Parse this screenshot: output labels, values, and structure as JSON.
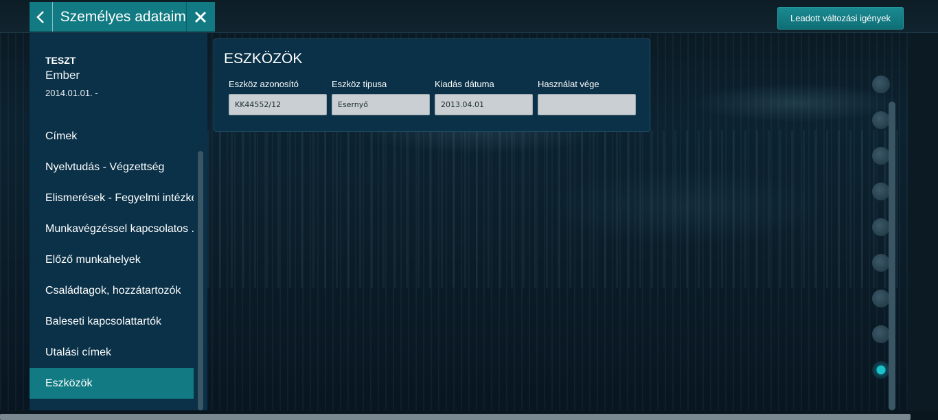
{
  "header": {
    "title": "Személyes adataim",
    "change_requests_button": "Leadott változási igények"
  },
  "user": {
    "name": "TESZT",
    "subname": "Ember",
    "date": "2014.01.01. -"
  },
  "sidebar": {
    "items": [
      {
        "label": "Címek"
      },
      {
        "label": "Nyelvtudás - Végzettség"
      },
      {
        "label": "Elismerések - Fegyelmi intézke."
      },
      {
        "label": "Munkavégzéssel kapcsolatos ..."
      },
      {
        "label": "Előző munkahelyek"
      },
      {
        "label": "Családtagok, hozzátartozók"
      },
      {
        "label": "Baleseti kapcsolattartók"
      },
      {
        "label": "Utalási címek"
      },
      {
        "label": "Eszközök",
        "active": true
      }
    ]
  },
  "section": {
    "title": "ESZKÖZÖK",
    "fields": [
      {
        "label": "Eszköz azonosító",
        "value": "KK44552/12"
      },
      {
        "label": "Eszköz tipusa",
        "value": "Esernyő"
      },
      {
        "label": "Kiadás dátuma",
        "value": "2013.04.01"
      },
      {
        "label": "Használat vége",
        "value": ""
      }
    ]
  },
  "pager": {
    "count": 9,
    "active_index": 8
  },
  "icons": {
    "back": "chevron-left-icon",
    "close": "close-icon"
  },
  "colors": {
    "accent": "#117a82",
    "panel": "#0a3148",
    "active_dot": "#1ac3c9"
  }
}
